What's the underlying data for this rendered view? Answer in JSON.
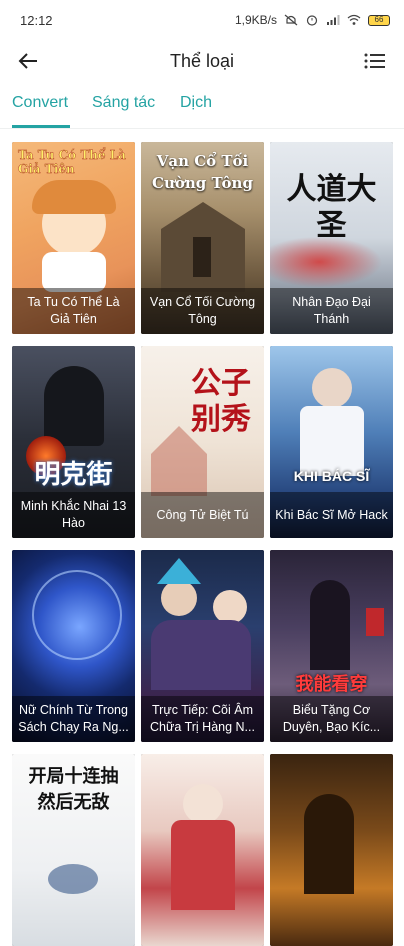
{
  "status": {
    "time": "12:12",
    "speed": "1,9KB/s",
    "battery": "66"
  },
  "header": {
    "title": "Thể loại"
  },
  "tabs": [
    {
      "label": "Convert"
    },
    {
      "label": "Sáng tác"
    },
    {
      "label": "Dịch"
    }
  ],
  "colors": {
    "accent": "#24a3a3"
  },
  "books": [
    {
      "title": "Ta Tu Có Thể Là Giả Tiên",
      "cover_text": "Ta Tu Có Thể Là Giả Tiên"
    },
    {
      "title": "Vạn Cổ Tối Cường Tông",
      "cover_text": "Vạn Cổ Tối Cường Tông"
    },
    {
      "title": "Nhân Đạo Đại Thánh",
      "cover_text": "人道大圣"
    },
    {
      "title": "Minh Khắc Nhai 13 Hào",
      "cover_text": "明克街"
    },
    {
      "title": "Công Tử Biệt Tú",
      "cover_text": "公子别秀"
    },
    {
      "title": "Khi Bác Sĩ Mở Hack",
      "cover_text": "KHI BÁC SĨ"
    },
    {
      "title": "Nữ Chính Từ Trong Sách Chạy Ra Ng...",
      "cover_text": ""
    },
    {
      "title": "Trực Tiếp: Cõi Âm Chữa Trị Hàng N...",
      "cover_text": ""
    },
    {
      "title": "Biểu Tặng Cơ Duyên, Bạo Kíc...",
      "cover_text": "我能看穿"
    },
    {
      "title": "",
      "cover_text": "开局十连抽 然后无敌"
    },
    {
      "title": "",
      "cover_text": ""
    },
    {
      "title": "",
      "cover_text": ""
    }
  ]
}
